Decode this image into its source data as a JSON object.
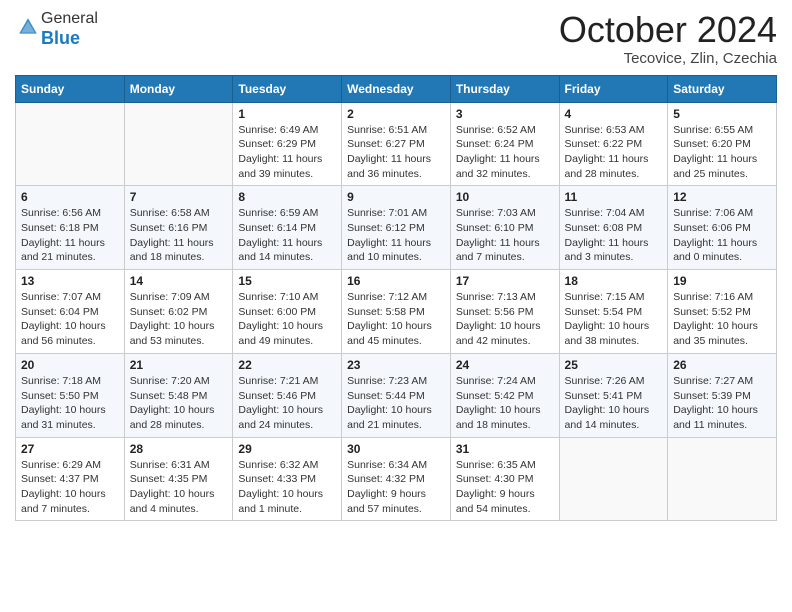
{
  "header": {
    "logo_general": "General",
    "logo_blue": "Blue",
    "cal_title": "October 2024",
    "cal_subtitle": "Tecovice, Zlin, Czechia"
  },
  "days_of_week": [
    "Sunday",
    "Monday",
    "Tuesday",
    "Wednesday",
    "Thursday",
    "Friday",
    "Saturday"
  ],
  "weeks": [
    [
      {
        "day": "",
        "info": ""
      },
      {
        "day": "",
        "info": ""
      },
      {
        "day": "1",
        "info": "Sunrise: 6:49 AM\nSunset: 6:29 PM\nDaylight: 11 hours and 39 minutes."
      },
      {
        "day": "2",
        "info": "Sunrise: 6:51 AM\nSunset: 6:27 PM\nDaylight: 11 hours and 36 minutes."
      },
      {
        "day": "3",
        "info": "Sunrise: 6:52 AM\nSunset: 6:24 PM\nDaylight: 11 hours and 32 minutes."
      },
      {
        "day": "4",
        "info": "Sunrise: 6:53 AM\nSunset: 6:22 PM\nDaylight: 11 hours and 28 minutes."
      },
      {
        "day": "5",
        "info": "Sunrise: 6:55 AM\nSunset: 6:20 PM\nDaylight: 11 hours and 25 minutes."
      }
    ],
    [
      {
        "day": "6",
        "info": "Sunrise: 6:56 AM\nSunset: 6:18 PM\nDaylight: 11 hours and 21 minutes."
      },
      {
        "day": "7",
        "info": "Sunrise: 6:58 AM\nSunset: 6:16 PM\nDaylight: 11 hours and 18 minutes."
      },
      {
        "day": "8",
        "info": "Sunrise: 6:59 AM\nSunset: 6:14 PM\nDaylight: 11 hours and 14 minutes."
      },
      {
        "day": "9",
        "info": "Sunrise: 7:01 AM\nSunset: 6:12 PM\nDaylight: 11 hours and 10 minutes."
      },
      {
        "day": "10",
        "info": "Sunrise: 7:03 AM\nSunset: 6:10 PM\nDaylight: 11 hours and 7 minutes."
      },
      {
        "day": "11",
        "info": "Sunrise: 7:04 AM\nSunset: 6:08 PM\nDaylight: 11 hours and 3 minutes."
      },
      {
        "day": "12",
        "info": "Sunrise: 7:06 AM\nSunset: 6:06 PM\nDaylight: 11 hours and 0 minutes."
      }
    ],
    [
      {
        "day": "13",
        "info": "Sunrise: 7:07 AM\nSunset: 6:04 PM\nDaylight: 10 hours and 56 minutes."
      },
      {
        "day": "14",
        "info": "Sunrise: 7:09 AM\nSunset: 6:02 PM\nDaylight: 10 hours and 53 minutes."
      },
      {
        "day": "15",
        "info": "Sunrise: 7:10 AM\nSunset: 6:00 PM\nDaylight: 10 hours and 49 minutes."
      },
      {
        "day": "16",
        "info": "Sunrise: 7:12 AM\nSunset: 5:58 PM\nDaylight: 10 hours and 45 minutes."
      },
      {
        "day": "17",
        "info": "Sunrise: 7:13 AM\nSunset: 5:56 PM\nDaylight: 10 hours and 42 minutes."
      },
      {
        "day": "18",
        "info": "Sunrise: 7:15 AM\nSunset: 5:54 PM\nDaylight: 10 hours and 38 minutes."
      },
      {
        "day": "19",
        "info": "Sunrise: 7:16 AM\nSunset: 5:52 PM\nDaylight: 10 hours and 35 minutes."
      }
    ],
    [
      {
        "day": "20",
        "info": "Sunrise: 7:18 AM\nSunset: 5:50 PM\nDaylight: 10 hours and 31 minutes."
      },
      {
        "day": "21",
        "info": "Sunrise: 7:20 AM\nSunset: 5:48 PM\nDaylight: 10 hours and 28 minutes."
      },
      {
        "day": "22",
        "info": "Sunrise: 7:21 AM\nSunset: 5:46 PM\nDaylight: 10 hours and 24 minutes."
      },
      {
        "day": "23",
        "info": "Sunrise: 7:23 AM\nSunset: 5:44 PM\nDaylight: 10 hours and 21 minutes."
      },
      {
        "day": "24",
        "info": "Sunrise: 7:24 AM\nSunset: 5:42 PM\nDaylight: 10 hours and 18 minutes."
      },
      {
        "day": "25",
        "info": "Sunrise: 7:26 AM\nSunset: 5:41 PM\nDaylight: 10 hours and 14 minutes."
      },
      {
        "day": "26",
        "info": "Sunrise: 7:27 AM\nSunset: 5:39 PM\nDaylight: 10 hours and 11 minutes."
      }
    ],
    [
      {
        "day": "27",
        "info": "Sunrise: 6:29 AM\nSunset: 4:37 PM\nDaylight: 10 hours and 7 minutes."
      },
      {
        "day": "28",
        "info": "Sunrise: 6:31 AM\nSunset: 4:35 PM\nDaylight: 10 hours and 4 minutes."
      },
      {
        "day": "29",
        "info": "Sunrise: 6:32 AM\nSunset: 4:33 PM\nDaylight: 10 hours and 1 minute."
      },
      {
        "day": "30",
        "info": "Sunrise: 6:34 AM\nSunset: 4:32 PM\nDaylight: 9 hours and 57 minutes."
      },
      {
        "day": "31",
        "info": "Sunrise: 6:35 AM\nSunset: 4:30 PM\nDaylight: 9 hours and 54 minutes."
      },
      {
        "day": "",
        "info": ""
      },
      {
        "day": "",
        "info": ""
      }
    ]
  ]
}
